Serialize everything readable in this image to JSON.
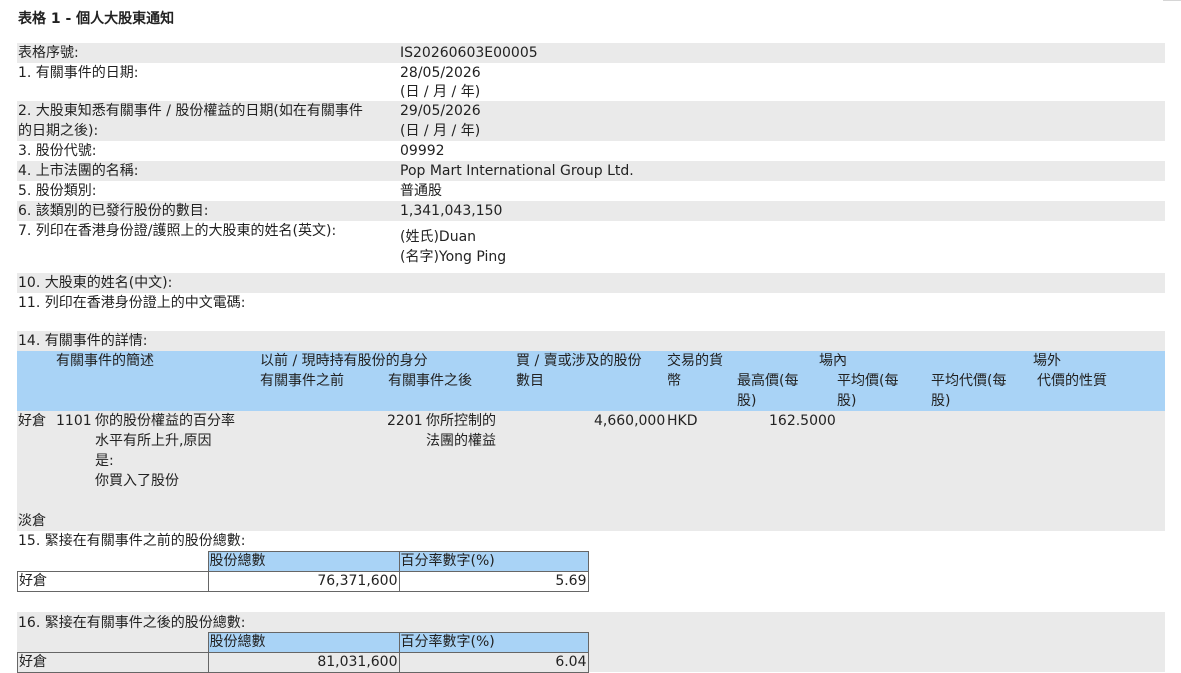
{
  "title": "表格 1 - 個人大股東通知",
  "fields": {
    "serial_label": "表格序號:",
    "serial_value": "IS20260603E00005",
    "f1_label": "1. 有關事件的日期:",
    "f1_value": "28/05/2026",
    "f1_hint": "(日 / 月 / 年)",
    "f2_label_a": "2. 大股東知悉有關事件 / 股份權益的日期(如在有關事件",
    "f2_label_b": "的日期之後):",
    "f2_value": "29/05/2026",
    "f2_hint": "(日 / 月 / 年)",
    "f3_label": "3. 股份代號:",
    "f3_value": "09992",
    "f4_label": "4. 上市法團的名稱:",
    "f4_value": "Pop Mart International Group Ltd.",
    "f5_label": "5. 股份類別:",
    "f5_value": "普通股",
    "f6_label": "6. 該類別的已發行股份的數目:",
    "f6_value": "1,341,043,150",
    "f7_label": "7. 列印在香港身份證/護照上的大股東的姓名(英文):",
    "f7_surname": "(姓氏)Duan",
    "f7_given": "(名字)Yong Ping",
    "f10_label": "10. 大股東的姓名(中文):",
    "f11_label": "11. 列印在香港身份證上的中文電碼:"
  },
  "event": {
    "section_label": "14. 有關事件的詳情:",
    "headers": {
      "desc": "有關事件的簡述",
      "capacity": "以前 / 現時持有股份的身分",
      "before": "有關事件之前",
      "after": "有關事件之後",
      "shares_a": "買 / 賣或涉及的股份",
      "shares_b": "數目",
      "currency_a": "交易的貨",
      "currency_b": "幣",
      "onex": "場內",
      "high_a": "最高價(每",
      "high_b": "股)",
      "avg_a": "平均價(每",
      "avg_b": "股)",
      "offex": "場外",
      "offavg_a": "平均代價(每",
      "offavg_b": "股)",
      "nature": "代價的性質"
    },
    "long_label": "好倉",
    "code": "1101",
    "desc_lines": [
      "你的股份權益的百分率",
      "水平有所上升,原因",
      "是:",
      "你買入了股份"
    ],
    "after_code": "2201",
    "after_lines": [
      "你所控制的",
      "法團的權益"
    ],
    "shares": "4,660,000",
    "currency": "HKD",
    "avg_price": "162.5000",
    "short_label": "淡倉"
  },
  "total_before": {
    "label": "15. 緊接在有關事件之前的股份總數:",
    "col1": "股份總數",
    "col2": "百分率數字(%)",
    "row_label": "好倉",
    "shares": "76,371,600",
    "percent": "5.69"
  },
  "total_after": {
    "label": "16. 緊接在有關事件之後的股份總數:",
    "col1": "股份總數",
    "col2": "百分率數字(%)",
    "row_label": "好倉",
    "shares": "81,031,600",
    "percent": "6.04"
  },
  "colors": {
    "gray_band": "#eaeaea",
    "header_blue": "#a9d3f6"
  }
}
